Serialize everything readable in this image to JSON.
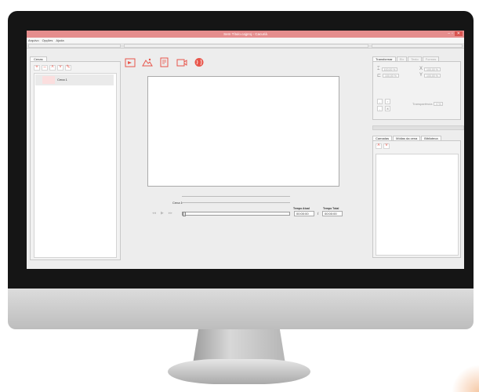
{
  "window": {
    "title": "Sem Título.cajproj - Cacurià",
    "min": "‒",
    "max": "▫",
    "close": "✕"
  },
  "menu": [
    "Arquivo",
    "Opções",
    "Ajuda"
  ],
  "left": {
    "tab": "Cenas",
    "buttons": [
      "+",
      "–",
      "˄",
      "˅",
      "✎"
    ],
    "scenes": [
      {
        "label": "Cena 1"
      }
    ]
  },
  "toolbar": [
    "add-image-icon",
    "add-chart-icon",
    "add-document-icon",
    "add-video-icon",
    "add-globe-icon"
  ],
  "center": {
    "scene_name": "Cena 1",
    "current_time_label": "Tempo Atual",
    "total_time_label": "Tempo Total",
    "current_time": "00:00:00",
    "separator": "/",
    "total_time": "00:00:00",
    "controls": [
      "◂◂",
      "▶",
      "▸▸"
    ],
    "progress": 0
  },
  "right": {
    "tabs": [
      "Transformar",
      "Eix",
      "Texto",
      "Formas"
    ],
    "props": {
      "w": "100,00 %",
      "h": "100,00 %",
      "x": "100,00 %",
      "y": "100,00 %"
    },
    "transparency_label": "Transparência",
    "transparency_value": "0 %",
    "tabs2": [
      "Camadas",
      "Mídias da cena",
      "Biblioteca"
    ],
    "buttons": [
      "˄",
      "˅"
    ]
  },
  "colors": {
    "accent": "#e8554a",
    "titlebar": "#e58d8d"
  }
}
